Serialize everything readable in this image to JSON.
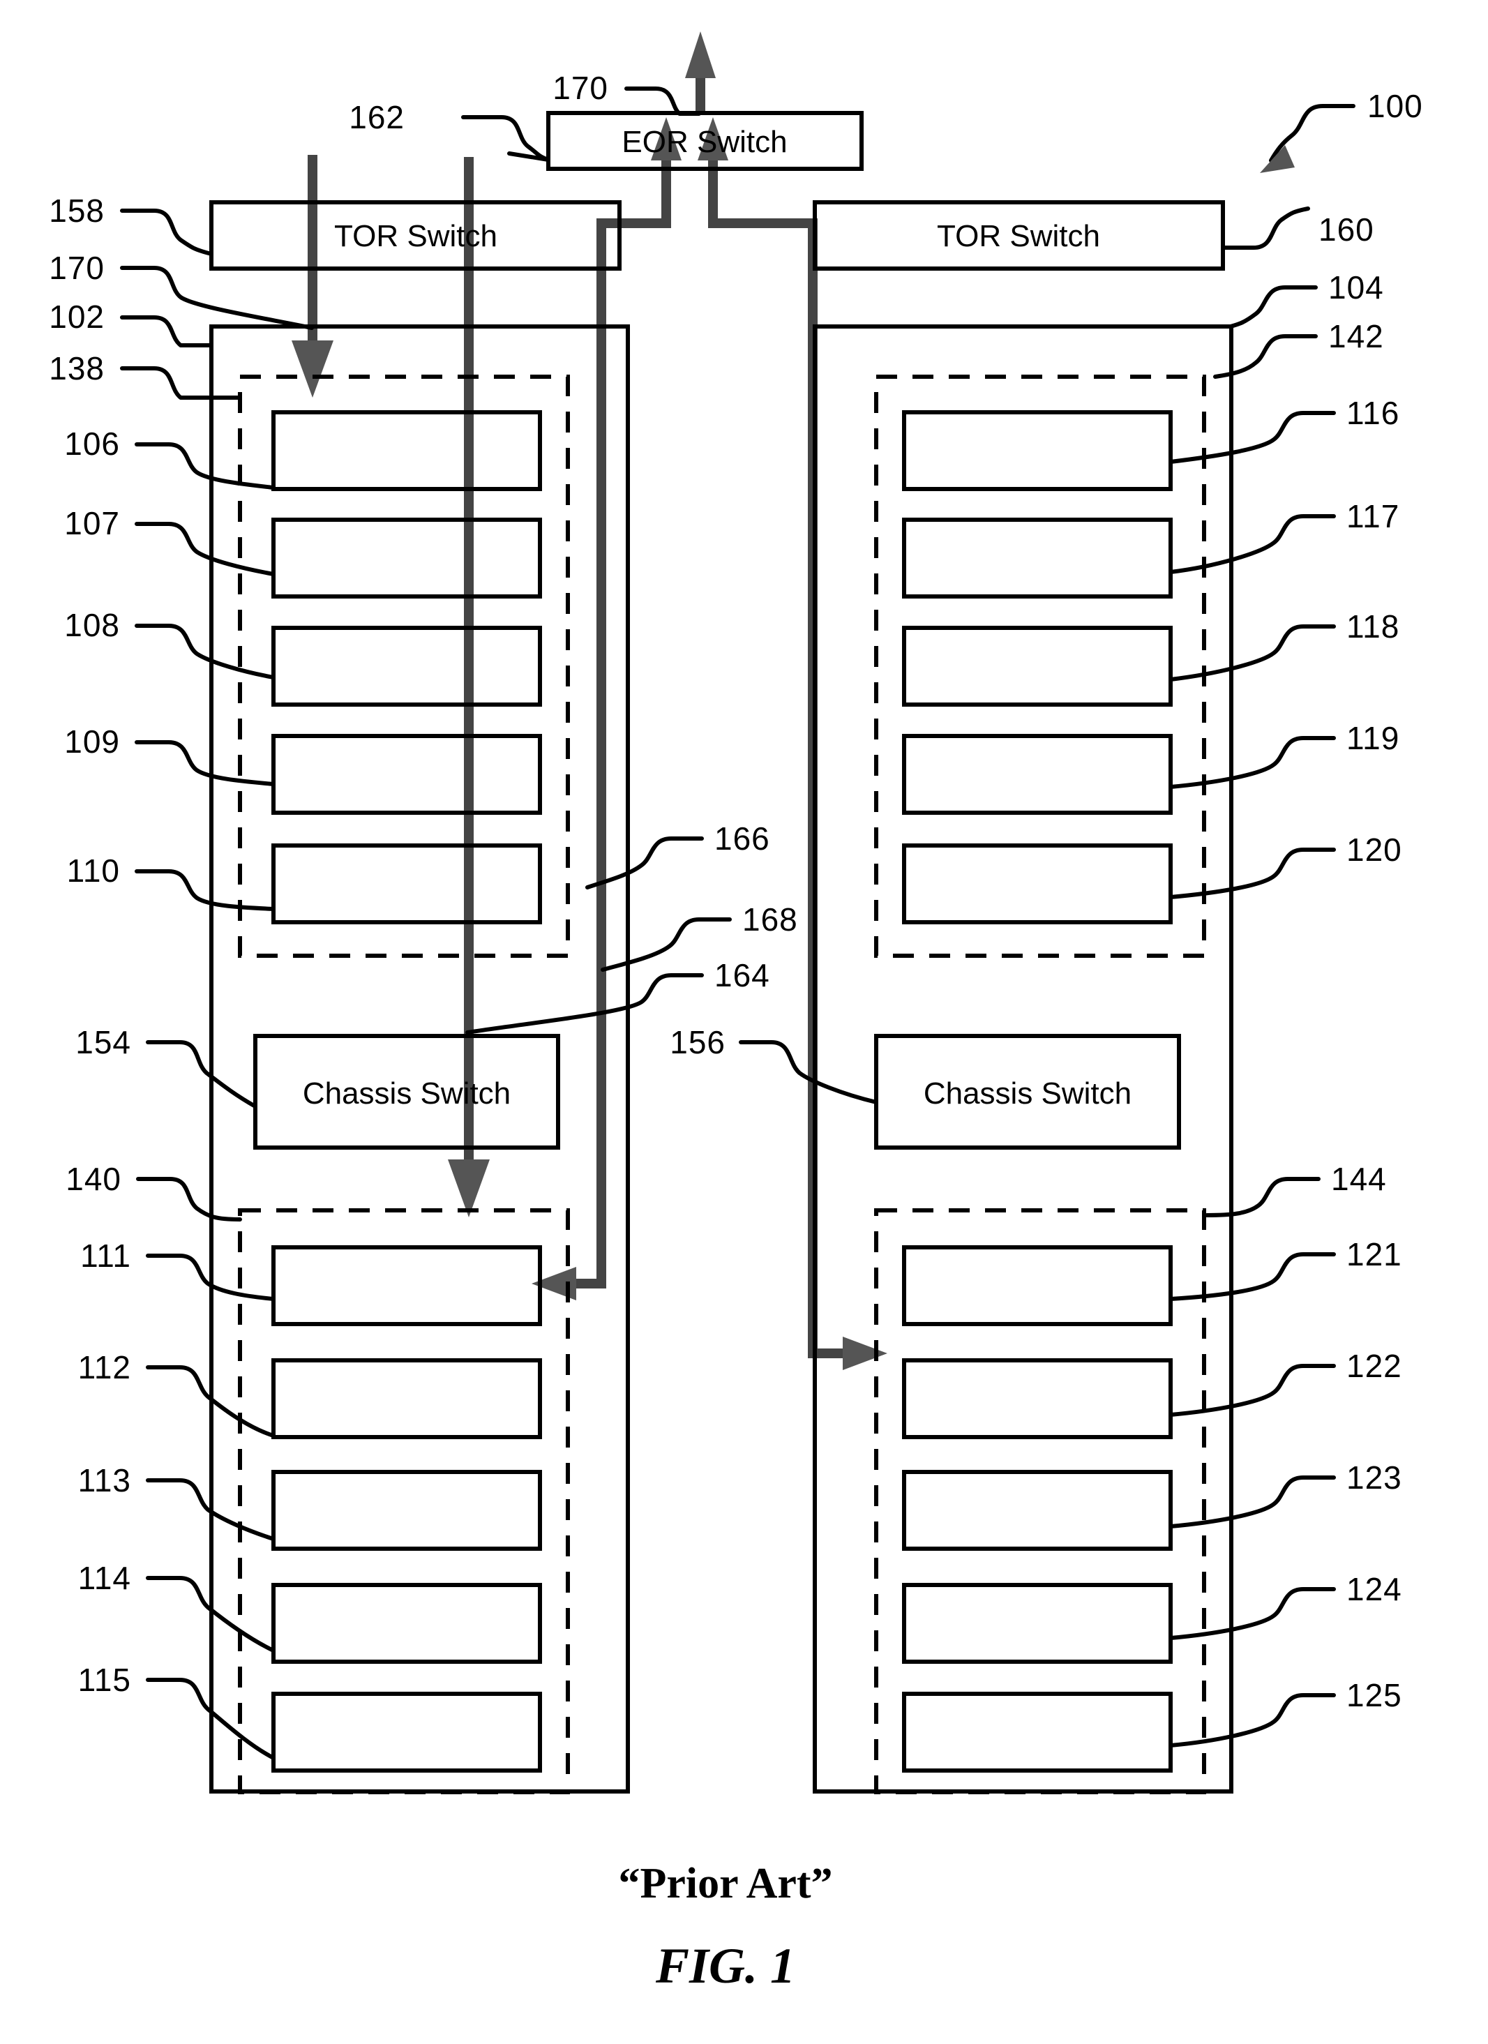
{
  "figure": {
    "caption_prior_art": "“Prior Art”",
    "caption_fig": "FIG. 1",
    "system_ref": "100"
  },
  "switches": {
    "eor": {
      "label": "EOR Switch",
      "ref": "162",
      "uplink_ref": "170"
    },
    "tor_left": {
      "label": "TOR Switch",
      "ref": "158",
      "link_ref": "170"
    },
    "tor_right": {
      "label": "TOR Switch",
      "ref": "160"
    },
    "chassis_left": {
      "label": "Chassis Switch",
      "ref": "154"
    },
    "chassis_right": {
      "label": "Chassis Switch",
      "ref": "156"
    }
  },
  "racks": {
    "left": {
      "ref": "102"
    },
    "right": {
      "ref": "104"
    }
  },
  "groups": {
    "left_upper": {
      "ref": "138"
    },
    "left_lower": {
      "ref": "140"
    },
    "right_upper": {
      "ref": "142"
    },
    "right_lower": {
      "ref": "144"
    }
  },
  "servers": {
    "left_upper": [
      "106",
      "107",
      "108",
      "109",
      "110"
    ],
    "left_lower": [
      "111",
      "112",
      "113",
      "114",
      "115"
    ],
    "right_upper": [
      "116",
      "117",
      "118",
      "119",
      "120"
    ],
    "right_lower": [
      "121",
      "122",
      "123",
      "124",
      "125"
    ]
  },
  "paths": {
    "intra_rack_ref": "164",
    "inter_rack_ref": "166",
    "cross_rack_ref": "168"
  }
}
